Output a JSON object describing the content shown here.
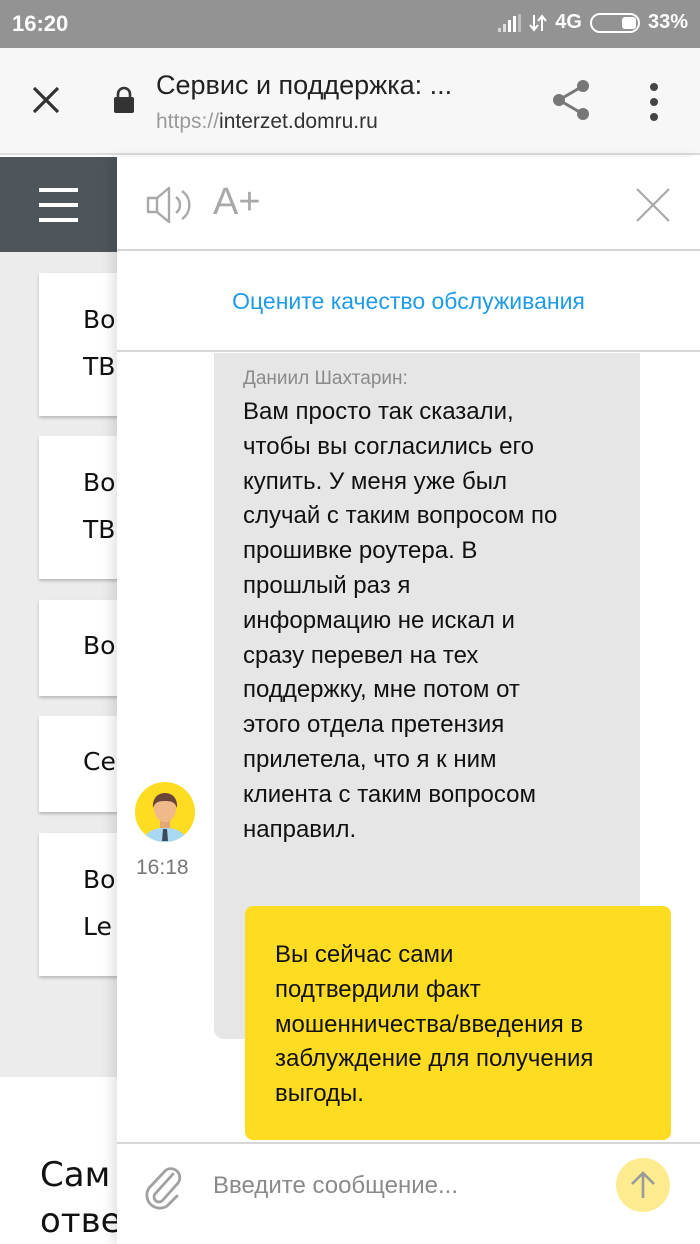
{
  "status_bar": {
    "time": "16:20",
    "network": "4G",
    "battery": "33%",
    "icons": [
      "signal-icon",
      "data-arrows-icon",
      "battery-icon"
    ]
  },
  "browser": {
    "page_title": "Сервис и поддержка: ...",
    "url_scheme": "https://",
    "url_host": "interzet.domru.ru",
    "icons": [
      "close-icon",
      "lock-icon",
      "share-icon",
      "more-vert-icon"
    ]
  },
  "background_page": {
    "cards": [
      {
        "line1": "Во",
        "line2": "ТВ"
      },
      {
        "line1": "Во",
        "line2": "ТВ"
      },
      {
        "line1": "Во",
        "line2": ""
      },
      {
        "line1": "Се",
        "line2": ""
      },
      {
        "line1": "Во",
        "line2": "Le"
      }
    ],
    "bottom_line1": "Сам",
    "bottom_line2": "отве"
  },
  "chat": {
    "header": {
      "font_size_label": "A+",
      "icons": [
        "speaker-icon",
        "close-icon"
      ]
    },
    "rate_link": "Оцените качество обслуживания",
    "messages": [
      {
        "direction": "incoming",
        "sender": "Даниил Шахтарин:",
        "text": "Вам просто так сказали,\nчтобы вы согласились его\nкупить. У меня уже был\nслучай с таким вопросом по\nпрошивке роутера. В\nпрошлый раз я\nинформацию не искал и\nсразу перевел на тех\nподдержку, мне потом от\nэтого отдела претензия\nприлетела, что я к ним\nклиента с таким вопросом\nнаправил.",
        "time": "16:18"
      },
      {
        "direction": "outgoing",
        "text": "Вы сейчас сами\nподтвердили факт\nмошенничества/введения в\nзаблуждение для получения\nвыгоды."
      }
    ],
    "composer": {
      "placeholder": "Введите сообщение...",
      "value": ""
    }
  },
  "colors": {
    "status_bar": "#939393",
    "link": "#1e9be8",
    "incoming_bubble": "#e6e6e6",
    "outgoing_bubble": "#fedc22",
    "send_button": "#fdeb90",
    "hamburger_bg": "#4e555b"
  }
}
